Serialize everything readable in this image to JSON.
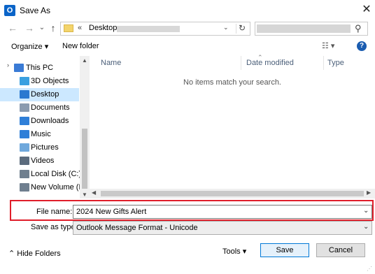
{
  "window": {
    "title": "Save As",
    "close_glyph": "✕",
    "app_icon_label": "O"
  },
  "nav": {
    "back": "←",
    "forward": "→",
    "history": "⌄",
    "up": "↑"
  },
  "address": {
    "prefix": "«",
    "crumb": "Desktop",
    "chevron": "›",
    "dropdown": "⌄",
    "refresh": "↻"
  },
  "search": {
    "icon": "⚲"
  },
  "toolbar": {
    "organize": "Organize ▾",
    "new_folder": "New folder",
    "view": "☷ ▾",
    "help": "?"
  },
  "sidebar": {
    "items": [
      {
        "label": "This PC",
        "icon": "computer-icon",
        "color": "#3a7bd5"
      },
      {
        "label": "3D Objects",
        "icon": "3d-objects-icon",
        "color": "#3aa0e0"
      },
      {
        "label": "Desktop",
        "icon": "desktop-icon",
        "color": "#2b79d0",
        "selected": true
      },
      {
        "label": "Documents",
        "icon": "documents-icon",
        "color": "#8a9bb0"
      },
      {
        "label": "Downloads",
        "icon": "downloads-icon",
        "color": "#2f7fd8"
      },
      {
        "label": "Music",
        "icon": "music-icon",
        "color": "#2f7fd8"
      },
      {
        "label": "Pictures",
        "icon": "pictures-icon",
        "color": "#6fa8dc"
      },
      {
        "label": "Videos",
        "icon": "videos-icon",
        "color": "#5b6b7d"
      },
      {
        "label": "Local Disk (C:)",
        "icon": "drive-icon",
        "color": "#6f7f8f"
      },
      {
        "label": "New Volume (D:",
        "icon": "drive-icon",
        "color": "#6f7f8f"
      }
    ]
  },
  "filelist": {
    "columns": [
      "Name",
      "Date modified",
      "Type"
    ],
    "empty_message": "No items match your search."
  },
  "form": {
    "file_name_label": "File name:",
    "file_name_value": "2024 New Gifts Alert",
    "save_type_label": "Save as type:",
    "save_type_value": "Outlook Message Format - Unicode"
  },
  "footer": {
    "hide_folders": "⌃  Hide Folders",
    "tools": "Tools   ▾",
    "save": "Save",
    "cancel": "Cancel"
  },
  "colors": {
    "highlight": "#e01e2a",
    "selection": "#cce8ff",
    "accent": "#0078d7"
  }
}
